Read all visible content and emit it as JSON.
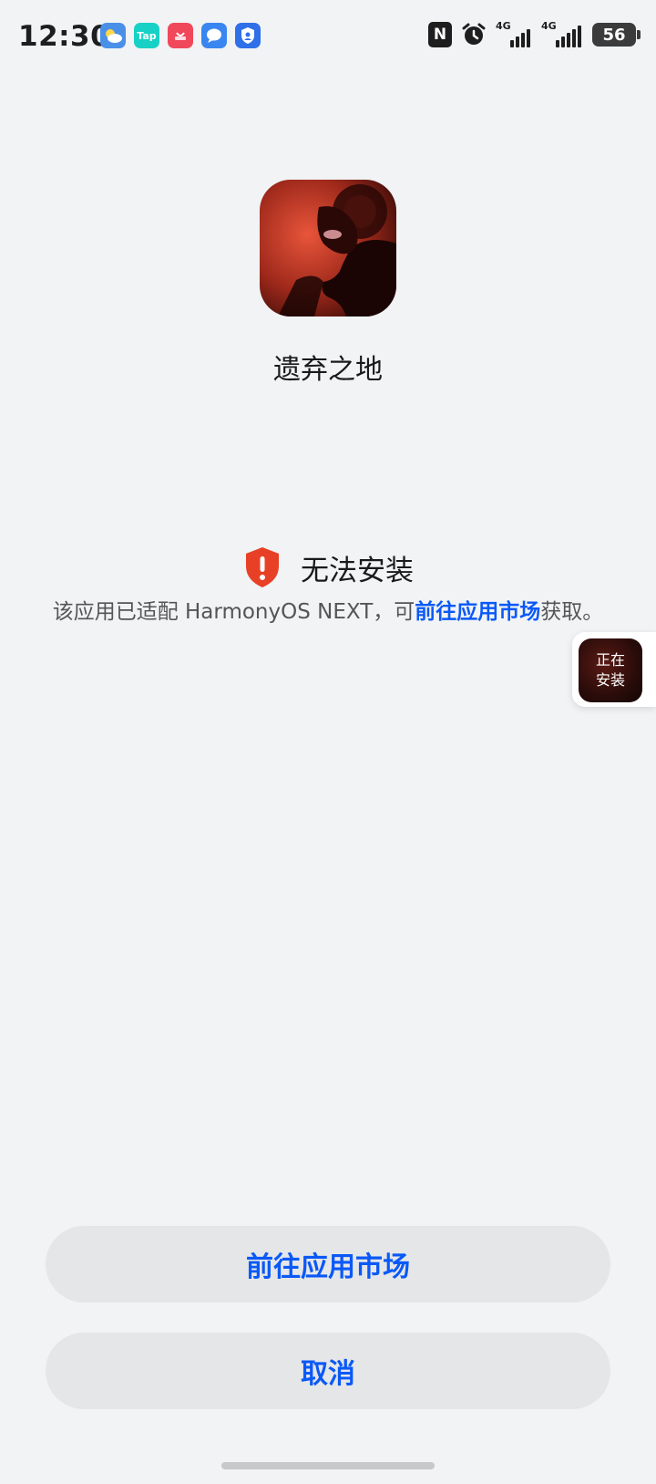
{
  "status_bar": {
    "time": "12:30",
    "notification_icons": [
      {
        "name": "weather-app-icon",
        "color": "#4a90e8",
        "label": ""
      },
      {
        "name": "taptap-app-icon",
        "color": "#18d1c6",
        "label": "Tap"
      },
      {
        "name": "app-gallery-icon",
        "color": "#f0475b",
        "label": ""
      },
      {
        "name": "messages-app-icon",
        "color": "#3a86f0",
        "label": ""
      },
      {
        "name": "security-app-icon",
        "color": "#2f6fe8",
        "label": ""
      }
    ],
    "nfc_label": "N",
    "network_type": "4G",
    "battery": "56"
  },
  "app": {
    "name": "遗弃之地"
  },
  "warning": {
    "title": "无法安装",
    "description_prefix": "该应用已适配 HarmonyOS NEXT，可",
    "description_link": "前往应用市场",
    "description_suffix": "获取。"
  },
  "floating_widget": {
    "line1": "正在",
    "line2": "安装"
  },
  "buttons": {
    "market_label": "前往应用市场",
    "cancel_label": "取消"
  },
  "colors": {
    "accent": "#0a59f7",
    "warning_red": "#e84026",
    "background": "#f1f3f5"
  }
}
